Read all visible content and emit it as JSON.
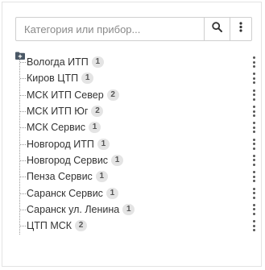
{
  "search": {
    "placeholder": "Категория или прибор...",
    "search_icon": "search-icon",
    "more_icon": "more-vertical-icon"
  },
  "tree": {
    "root_icon": "folder-plus-icon",
    "items": [
      {
        "label": "Вологда ИТП",
        "count": "1"
      },
      {
        "label": "Киров ЦТП",
        "count": "1"
      },
      {
        "label": "МСК ИТП Север",
        "count": "2"
      },
      {
        "label": "МСК ИТП Юг",
        "count": "2"
      },
      {
        "label": "МСК Сервис",
        "count": "1"
      },
      {
        "label": "Новгород ИТП",
        "count": "1"
      },
      {
        "label": "Новгород Сервис",
        "count": "1"
      },
      {
        "label": "Пенза Сервис",
        "count": "1"
      },
      {
        "label": "Саранск Сервис",
        "count": "1"
      },
      {
        "label": "Саранск ул. Ленина",
        "count": "1"
      },
      {
        "label": "ЦТП МСК",
        "count": "2"
      }
    ]
  }
}
